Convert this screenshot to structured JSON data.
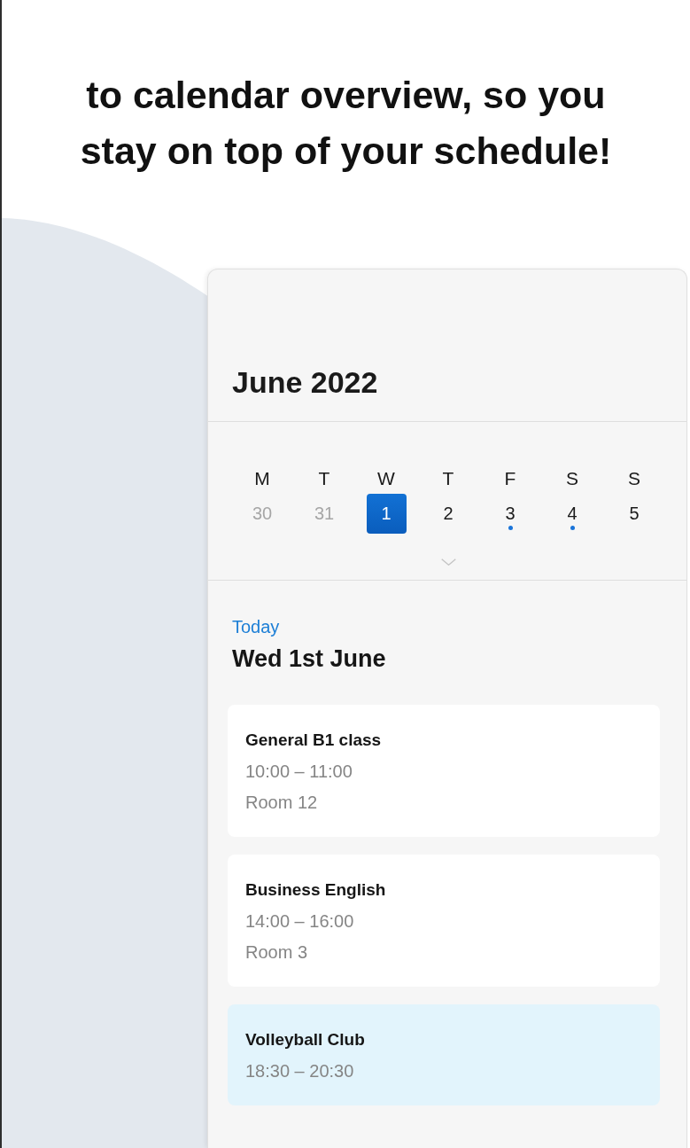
{
  "headline": "to calendar overview, so you stay on top of your schedule!",
  "calendar": {
    "month": "June 2022",
    "weekdays": [
      "M",
      "T",
      "W",
      "T",
      "F",
      "S",
      "S"
    ],
    "dates": [
      {
        "label": "30",
        "muted": true,
        "selected": false,
        "has_events": false
      },
      {
        "label": "31",
        "muted": true,
        "selected": false,
        "has_events": false
      },
      {
        "label": "1",
        "muted": false,
        "selected": true,
        "has_events": false
      },
      {
        "label": "2",
        "muted": false,
        "selected": false,
        "has_events": false
      },
      {
        "label": "3",
        "muted": false,
        "selected": false,
        "has_events": true
      },
      {
        "label": "4",
        "muted": false,
        "selected": false,
        "has_events": true
      },
      {
        "label": "5",
        "muted": false,
        "selected": false,
        "has_events": false
      }
    ]
  },
  "agenda": {
    "label": "Today",
    "date": "Wed 1st June",
    "events": [
      {
        "title": "General B1 class",
        "time": "10:00 – 11:00",
        "room": "Room 12",
        "color": "#ffffff"
      },
      {
        "title": "Business English",
        "time": "14:00 – 16:00",
        "room": "Room 3",
        "color": "#ffffff"
      },
      {
        "title": "Volleyball Club",
        "time": "18:30 – 20:30",
        "color": "#e2f4fc"
      }
    ]
  }
}
